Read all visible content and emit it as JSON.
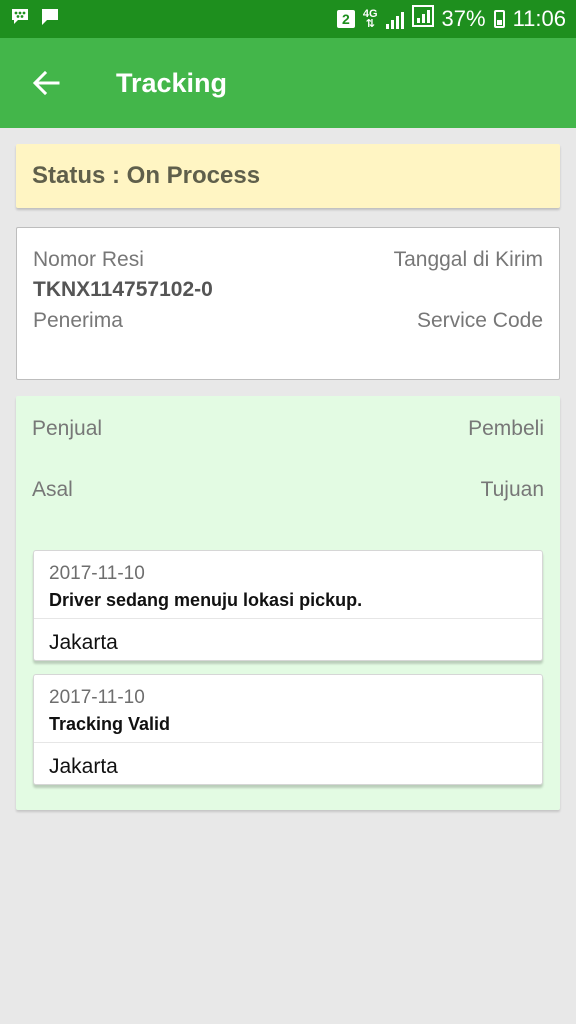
{
  "status_bar": {
    "sim_badge": "2",
    "network": "4G",
    "battery_percent": "37%",
    "time": "11:06",
    "icons": [
      "bbm-icon",
      "message-icon",
      "signal-icon",
      "battery-icon"
    ]
  },
  "app_bar": {
    "title": "Tracking",
    "background_color": "#43b64a"
  },
  "status": {
    "text": "Status : On Process",
    "background_color": "#fff5c3"
  },
  "info": {
    "nomor_resi_label": "Nomor Resi",
    "tanggal_label": "Tanggal di Kirim",
    "nomor_resi_value": "TKNX114757102-0",
    "penerima_label": "Penerima",
    "service_code_label": "Service Code"
  },
  "route": {
    "penjual_label": "Penjual",
    "pembeli_label": "Pembeli",
    "asal_label": "Asal",
    "tujuan_label": "Tujuan",
    "background_color": "#e3fbe3"
  },
  "tracking_items": [
    {
      "date": "2017-11-10",
      "message": "Driver sedang menuju lokasi pickup.",
      "city": "Jakarta"
    },
    {
      "date": "2017-11-10",
      "message": "Tracking Valid",
      "city": "Jakarta"
    }
  ]
}
